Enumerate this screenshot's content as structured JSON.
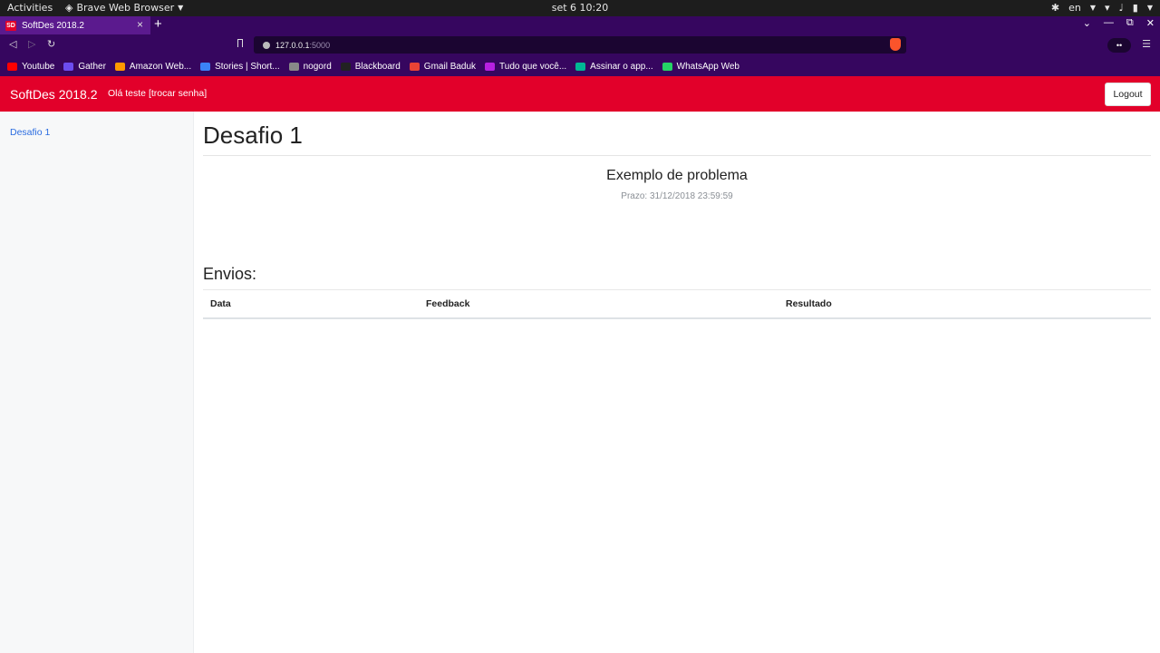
{
  "system": {
    "activities": "Activities",
    "app_name": "Brave Web Browser",
    "clock": "set 6  10:20",
    "language": "en"
  },
  "browser": {
    "tab_title": "SoftDes 2018.2",
    "favicon_text": "SD",
    "url_host": "127.0.0.1",
    "url_port": ":5000",
    "ext_label": "••"
  },
  "bookmarks": [
    {
      "label": "Youtube",
      "color": "#ff0000"
    },
    {
      "label": "Gather",
      "color": "#6c4cf0"
    },
    {
      "label": "Amazon Web...",
      "color": "#ff9900"
    },
    {
      "label": "Stories | Short...",
      "color": "#3b82f6"
    },
    {
      "label": "nogord",
      "color": "#888888"
    },
    {
      "label": "Blackboard",
      "color": "#222222"
    },
    {
      "label": "Gmail Baduk",
      "color": "#ea4335"
    },
    {
      "label": "Tudo que você...",
      "color": "#b620e0"
    },
    {
      "label": "Assinar o app...",
      "color": "#00b894"
    },
    {
      "label": "WhatsApp Web",
      "color": "#25d366"
    }
  ],
  "app": {
    "brand": "SoftDes 2018.2",
    "greeting": "Olá teste [trocar senha]",
    "logout": "Logout",
    "accent": "#e2002a"
  },
  "sidebar": {
    "items": [
      {
        "label": "Desafio 1"
      }
    ]
  },
  "main": {
    "title": "Desafio 1",
    "problem_title": "Exemplo de problema",
    "deadline": "Prazo: 31/12/2018 23:59:59",
    "submissions_heading": "Envios:",
    "columns": [
      "Data",
      "Feedback",
      "Resultado"
    ]
  }
}
